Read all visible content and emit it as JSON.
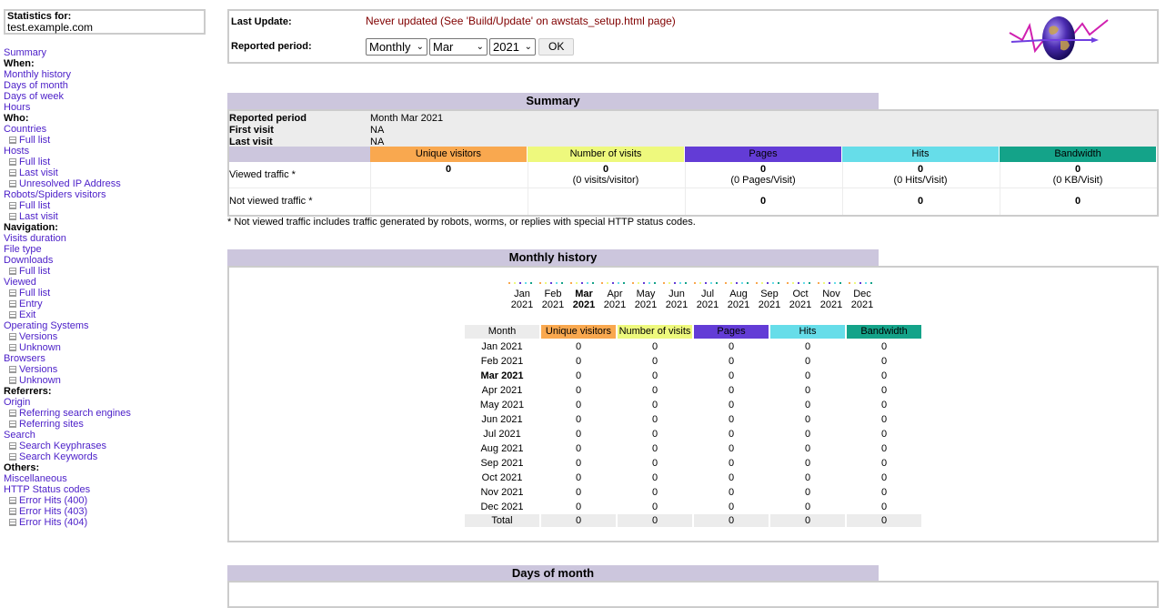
{
  "sidebar": {
    "stats_label": "Statistics for:",
    "host": "test.example.com",
    "menu": [
      {
        "label": "Summary",
        "type": "link"
      },
      {
        "label": "When:",
        "type": "header"
      },
      {
        "label": "Monthly history",
        "type": "link"
      },
      {
        "label": "Days of month",
        "type": "link"
      },
      {
        "label": "Days of week",
        "type": "link"
      },
      {
        "label": "Hours",
        "type": "link"
      },
      {
        "label": "Who:",
        "type": "header"
      },
      {
        "label": "Countries",
        "type": "link"
      },
      {
        "label": "Full list",
        "type": "sub"
      },
      {
        "label": "Hosts",
        "type": "link"
      },
      {
        "label": "Full list",
        "type": "sub"
      },
      {
        "label": "Last visit",
        "type": "sub"
      },
      {
        "label": "Unresolved IP Address",
        "type": "sub"
      },
      {
        "label": "Robots/Spiders visitors",
        "type": "link"
      },
      {
        "label": "Full list",
        "type": "sub"
      },
      {
        "label": "Last visit",
        "type": "sub"
      },
      {
        "label": "Navigation:",
        "type": "header"
      },
      {
        "label": "Visits duration",
        "type": "link"
      },
      {
        "label": "File type",
        "type": "link"
      },
      {
        "label": "Downloads",
        "type": "link"
      },
      {
        "label": "Full list",
        "type": "sub"
      },
      {
        "label": "Viewed",
        "type": "link"
      },
      {
        "label": "Full list",
        "type": "sub"
      },
      {
        "label": "Entry",
        "type": "sub"
      },
      {
        "label": "Exit",
        "type": "sub"
      },
      {
        "label": "Operating Systems",
        "type": "link"
      },
      {
        "label": "Versions",
        "type": "sub"
      },
      {
        "label": "Unknown",
        "type": "sub"
      },
      {
        "label": "Browsers",
        "type": "link"
      },
      {
        "label": "Versions",
        "type": "sub"
      },
      {
        "label": "Unknown",
        "type": "sub"
      },
      {
        "label": "Referrers:",
        "type": "header"
      },
      {
        "label": "Origin",
        "type": "link"
      },
      {
        "label": "Referring search engines",
        "type": "sub"
      },
      {
        "label": "Referring sites",
        "type": "sub"
      },
      {
        "label": "Search",
        "type": "link"
      },
      {
        "label": "Search Keyphrases",
        "type": "sub"
      },
      {
        "label": "Search Keywords",
        "type": "sub"
      },
      {
        "label": "Others:",
        "type": "header"
      },
      {
        "label": "Miscellaneous",
        "type": "link"
      },
      {
        "label": "HTTP Status codes",
        "type": "link"
      },
      {
        "label": "Error Hits (400)",
        "type": "sub"
      },
      {
        "label": "Error Hits (403)",
        "type": "sub"
      },
      {
        "label": "Error Hits (404)",
        "type": "sub"
      }
    ]
  },
  "header": {
    "last_update_label": "Last Update:",
    "last_update_value": "Never updated (See 'Build/Update' on awstats_setup.html page)",
    "reported_period_label": "Reported period:",
    "period_type": "Monthly",
    "period_month": "Mar",
    "period_year": "2021",
    "ok_label": "OK"
  },
  "summary": {
    "title": "Summary",
    "reported_period_label": "Reported period",
    "reported_period_value": "Month Mar 2021",
    "first_visit_label": "First visit",
    "first_visit_value": "NA",
    "last_visit_label": "Last visit",
    "last_visit_value": "NA",
    "columns": [
      {
        "label": "Unique visitors",
        "color": "#f9a84f"
      },
      {
        "label": "Number of visits",
        "color": "#eef97d"
      },
      {
        "label": "Pages",
        "color": "#633cd6"
      },
      {
        "label": "Hits",
        "color": "#66dde9"
      },
      {
        "label": "Bandwidth",
        "color": "#14a389"
      }
    ],
    "viewed_label": "Viewed traffic *",
    "viewed": [
      {
        "value": "0",
        "sub": ""
      },
      {
        "value": "0",
        "sub": "(0 visits/visitor)"
      },
      {
        "value": "0",
        "sub": "(0 Pages/Visit)"
      },
      {
        "value": "0",
        "sub": "(0 Hits/Visit)"
      },
      {
        "value": "0",
        "sub": "(0 KB/Visit)"
      }
    ],
    "not_viewed_label": "Not viewed traffic *",
    "not_viewed": [
      "0",
      "0",
      "0"
    ],
    "note": "* Not viewed traffic includes traffic generated by robots, worms, or replies with special HTTP status codes."
  },
  "monthly": {
    "title": "Monthly history",
    "chart_months": [
      {
        "m": "Jan",
        "y": "2021",
        "current": false
      },
      {
        "m": "Feb",
        "y": "2021",
        "current": false
      },
      {
        "m": "Mar",
        "y": "2021",
        "current": true
      },
      {
        "m": "Apr",
        "y": "2021",
        "current": false
      },
      {
        "m": "May",
        "y": "2021",
        "current": false
      },
      {
        "m": "Jun",
        "y": "2021",
        "current": false
      },
      {
        "m": "Jul",
        "y": "2021",
        "current": false
      },
      {
        "m": "Aug",
        "y": "2021",
        "current": false
      },
      {
        "m": "Sep",
        "y": "2021",
        "current": false
      },
      {
        "m": "Oct",
        "y": "2021",
        "current": false
      },
      {
        "m": "Nov",
        "y": "2021",
        "current": false
      },
      {
        "m": "Dec",
        "y": "2021",
        "current": false
      }
    ],
    "columns": [
      {
        "label": "Month",
        "color": "#ececec"
      },
      {
        "label": "Unique visitors",
        "color": "#f9a84f"
      },
      {
        "label": "Number of visits",
        "color": "#eef97d"
      },
      {
        "label": "Pages",
        "color": "#633cd6"
      },
      {
        "label": "Hits",
        "color": "#66dde9"
      },
      {
        "label": "Bandwidth",
        "color": "#14a389"
      }
    ],
    "rows": [
      {
        "month": "Jan 2021",
        "current": false,
        "values": [
          "0",
          "0",
          "0",
          "0",
          "0"
        ]
      },
      {
        "month": "Feb 2021",
        "current": false,
        "values": [
          "0",
          "0",
          "0",
          "0",
          "0"
        ]
      },
      {
        "month": "Mar 2021",
        "current": true,
        "values": [
          "0",
          "0",
          "0",
          "0",
          "0"
        ]
      },
      {
        "month": "Apr 2021",
        "current": false,
        "values": [
          "0",
          "0",
          "0",
          "0",
          "0"
        ]
      },
      {
        "month": "May 2021",
        "current": false,
        "values": [
          "0",
          "0",
          "0",
          "0",
          "0"
        ]
      },
      {
        "month": "Jun 2021",
        "current": false,
        "values": [
          "0",
          "0",
          "0",
          "0",
          "0"
        ]
      },
      {
        "month": "Jul 2021",
        "current": false,
        "values": [
          "0",
          "0",
          "0",
          "0",
          "0"
        ]
      },
      {
        "month": "Aug 2021",
        "current": false,
        "values": [
          "0",
          "0",
          "0",
          "0",
          "0"
        ]
      },
      {
        "month": "Sep 2021",
        "current": false,
        "values": [
          "0",
          "0",
          "0",
          "0",
          "0"
        ]
      },
      {
        "month": "Oct 2021",
        "current": false,
        "values": [
          "0",
          "0",
          "0",
          "0",
          "0"
        ]
      },
      {
        "month": "Nov 2021",
        "current": false,
        "values": [
          "0",
          "0",
          "0",
          "0",
          "0"
        ]
      },
      {
        "month": "Dec 2021",
        "current": false,
        "values": [
          "0",
          "0",
          "0",
          "0",
          "0"
        ]
      }
    ],
    "total": {
      "label": "Total",
      "values": [
        "0",
        "0",
        "0",
        "0",
        "0"
      ]
    }
  },
  "days": {
    "title": "Days of month"
  }
}
